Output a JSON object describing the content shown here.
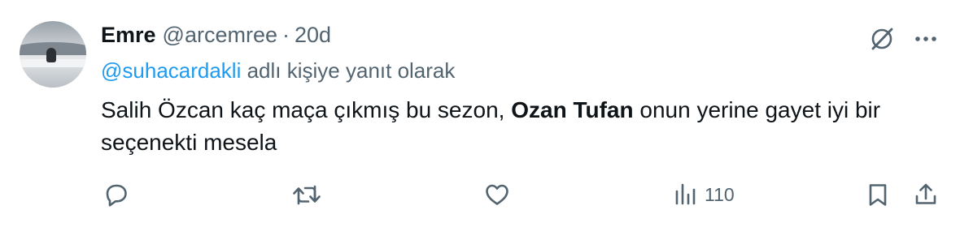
{
  "author": {
    "name": "Emre",
    "handle": "@arcemree",
    "separator": "·",
    "time": "20d"
  },
  "reply": {
    "mention": "@suhacardakli",
    "suffix": " adlı kişiye yanıt olarak"
  },
  "content": {
    "text_before": "Salih Özcan kaç maça çıkmış bu sezon, ",
    "bold": "Ozan Tufan",
    "text_after": " onun yerine gayet iyi bir seçenekti mesela"
  },
  "actions": {
    "views": "110"
  },
  "icons": {
    "grok": "grok-icon",
    "more": "more-icon",
    "reply": "reply-icon",
    "retweet": "retweet-icon",
    "like": "like-icon",
    "views": "views-icon",
    "bookmark": "bookmark-icon",
    "share": "share-icon"
  },
  "colors": {
    "text": "#0f1419",
    "secondary": "#536471",
    "link": "#1d9bf0",
    "background": "#ffffff"
  }
}
